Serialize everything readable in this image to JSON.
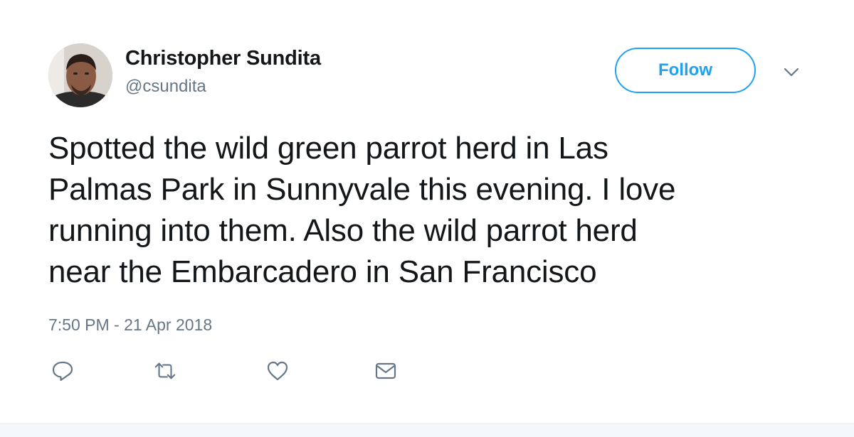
{
  "author": {
    "name": "Christopher Sundita",
    "handle": "@csundita"
  },
  "header": {
    "follow_label": "Follow",
    "menu_icon": "chevron-down-icon"
  },
  "tweet": {
    "text_lines": [
      "Spotted the wild green parrot herd in Las",
      "Palmas Park in Sunnyvale this evening. I love",
      "running into them. Also the wild parrot herd",
      "near the Embarcadero in San Francisco"
    ],
    "timestamp": "7:50 PM - 21 Apr 2018"
  },
  "actions": [
    {
      "name": "reply",
      "icon": "reply-icon"
    },
    {
      "name": "retweet",
      "icon": "retweet-icon"
    },
    {
      "name": "like",
      "icon": "heart-icon"
    },
    {
      "name": "direct-message",
      "icon": "envelope-icon"
    }
  ],
  "colors": {
    "accent": "#1da1f2",
    "text": "#14171a",
    "secondary_text": "#657786",
    "icon": "#657786"
  }
}
